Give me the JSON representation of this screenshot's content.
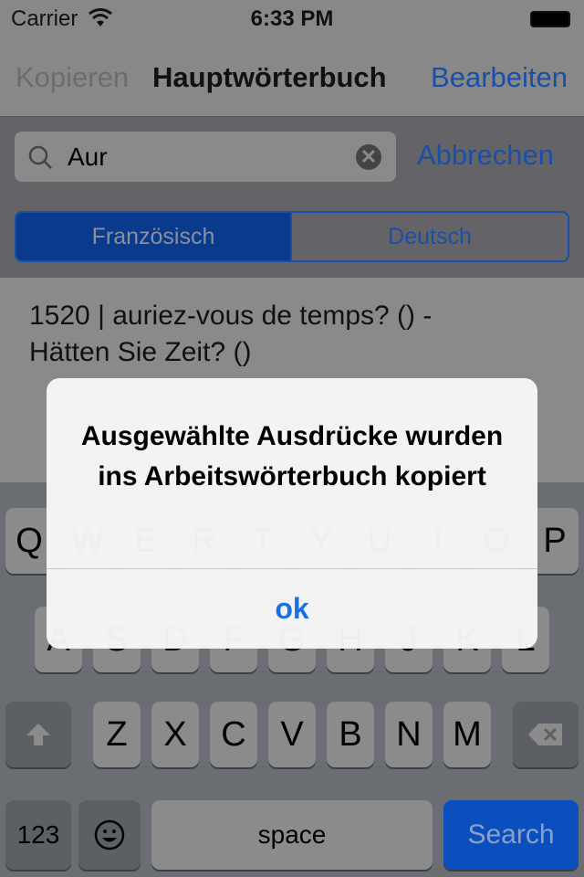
{
  "status_bar": {
    "carrier": "Carrier",
    "time": "6:33 PM"
  },
  "nav": {
    "left": "Kopieren",
    "title": "Hauptwörterbuch",
    "right": "Bearbeiten"
  },
  "search": {
    "value": "Aur",
    "cancel": "Abbrechen"
  },
  "segment": {
    "items": [
      "Französisch",
      "Deutsch"
    ],
    "selected": 0
  },
  "list": {
    "items": [
      {
        "line1": "1520 | auriez-vous de temps? () -",
        "line2": "Hätten Sie Zeit? ()"
      }
    ]
  },
  "alert": {
    "message": "Ausgewählte Ausdrücke wurden ins Arbeitswörterbuch kopiert",
    "button": "ok"
  },
  "keyboard": {
    "row1": [
      "Q",
      "W",
      "E",
      "R",
      "T",
      "Y",
      "U",
      "I",
      "O",
      "P"
    ],
    "row2": [
      "A",
      "S",
      "D",
      "F",
      "G",
      "H",
      "J",
      "K",
      "L"
    ],
    "row3": [
      "Z",
      "X",
      "C",
      "V",
      "B",
      "N",
      "M"
    ],
    "numbers": "123",
    "space": "space",
    "search": "Search"
  },
  "colors": {
    "accent": "#1a56c4",
    "search_key": "#0b4fbf"
  }
}
